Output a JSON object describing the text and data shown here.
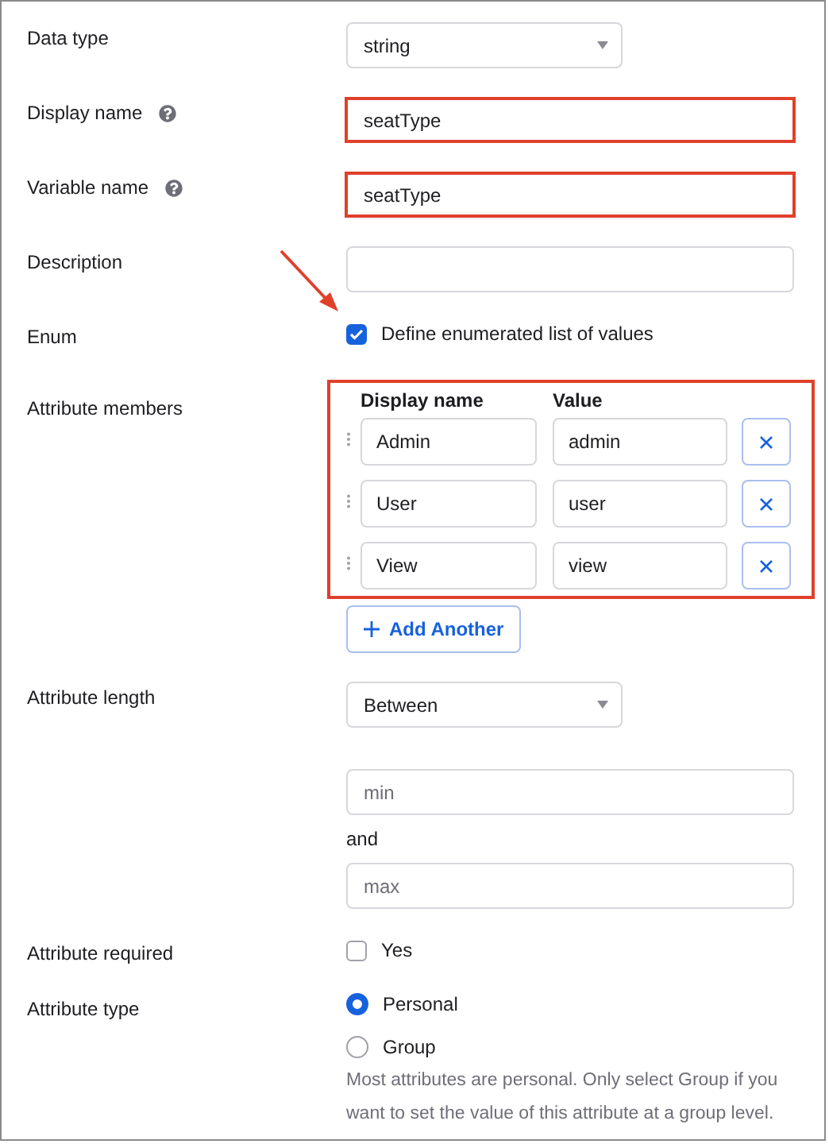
{
  "rows": [
    {
      "kind": "select",
      "label": "Data type",
      "value": "string"
    },
    {
      "kind": "text",
      "label": "Display name",
      "help": true,
      "value": "seatType",
      "highlighted": true
    },
    {
      "kind": "text",
      "label": "Variable name",
      "help": true,
      "value": "seatType",
      "highlighted": true
    },
    {
      "kind": "text",
      "label": "Description",
      "help": false,
      "value": "",
      "highlighted": false
    },
    {
      "kind": "checkbox",
      "label": "Enum",
      "text": "Define enumerated list of values",
      "checked": true
    },
    {
      "kind": "members",
      "label": "Attribute members",
      "highlighted": true,
      "columns": [
        "Display name",
        "Value"
      ],
      "members": [
        {
          "display": "Admin",
          "value": "admin"
        },
        {
          "display": "User",
          "value": "user"
        },
        {
          "display": "View",
          "value": "view"
        }
      ],
      "add_button": "Add Another"
    },
    {
      "kind": "length",
      "label": "Attribute length",
      "value": "Between",
      "min_placeholder": "min",
      "connector": "and",
      "max_placeholder": "max"
    },
    {
      "kind": "checkbox",
      "label": "Attribute required",
      "text": "Yes",
      "checked": false
    },
    {
      "kind": "radio",
      "label": "Attribute type",
      "options": [
        {
          "label": "Personal",
          "selected": true
        },
        {
          "label": "Group",
          "selected": false
        }
      ],
      "hint": "Most attributes are personal. Only select Group if you want to set the value of this attribute at a group level."
    }
  ]
}
